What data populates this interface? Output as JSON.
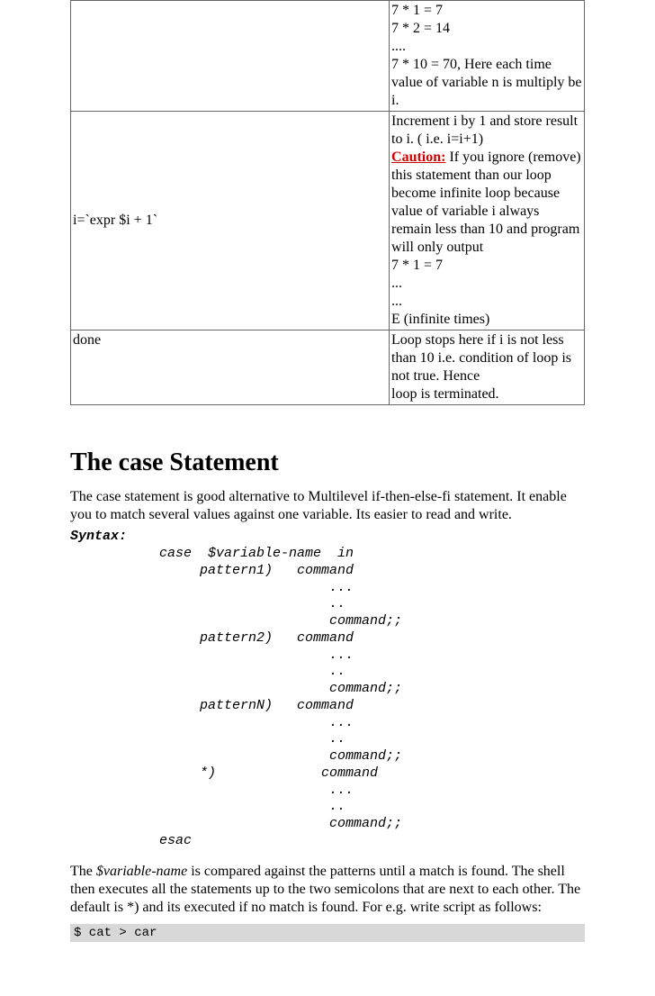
{
  "table": {
    "row1": {
      "left": "",
      "right": "7 * 1 = 7\n7 * 2 = 14\n....\n7 * 10 = 70, Here each time value of variable n is multiply be i."
    },
    "row2": {
      "left": "i=`expr $i + 1`",
      "right_pre": "Increment i by 1 and store result to i.  ( i.e. i=i+1)",
      "caution_label": "Caution:",
      "right_caution_rest": " If you ignore (remove) this statement  than our loop become infinite loop because value of variable i always remain less than 10 and program will only output",
      "right_post": "7 * 1 = 7\n...\n...\nE (infinite times)"
    },
    "row3": {
      "left": "done",
      "right": "Loop stops here if i is not less than 10 i.e. condition of loop is not true. Hence\nloop is terminated."
    }
  },
  "heading": "The case Statement",
  "intro": "The case statement is good alternative to Multilevel if-then-else-fi statement. It enable you to match several values against one variable. Its easier to read and write.",
  "syntax_label": "Syntax:",
  "syntax_code": "           case  $variable-name  in\n                pattern1)   command\n                                ...\n                                ..\n                                command;;\n                pattern2)   command\n                                ...\n                                ..\n                                command;;\n                patternN)   command\n                                ...\n                                ..\n                                command;;\n                *)             command\n                                ...\n                                ..\n                                command;;\n           esac",
  "para2_pre": "The ",
  "para2_var": "$variable-name",
  "para2_post": " is compared against the patterns until a match is found. The shell then executes all the statements up to the two semicolons that are next to each other. The default is *) and its executed if no match is found. For e.g. write script as follows:",
  "shell_cmd": "$ cat > car"
}
